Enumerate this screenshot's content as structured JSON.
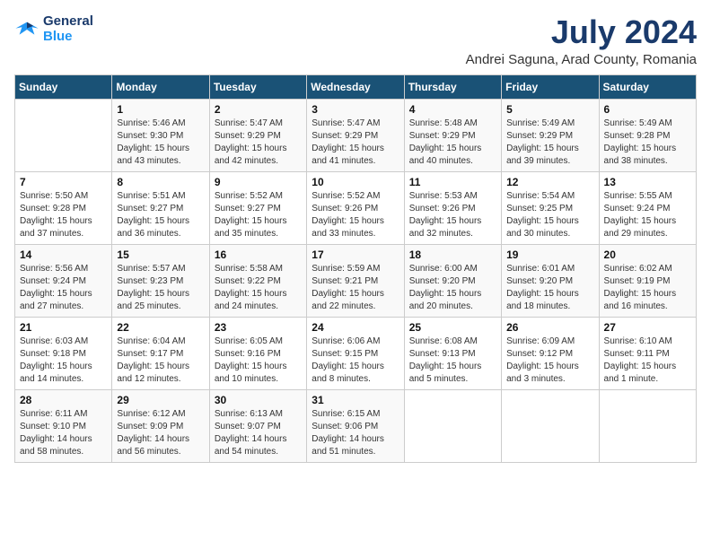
{
  "header": {
    "logo_line1": "General",
    "logo_line2": "Blue",
    "month": "July 2024",
    "location": "Andrei Saguna, Arad County, Romania"
  },
  "weekdays": [
    "Sunday",
    "Monday",
    "Tuesday",
    "Wednesday",
    "Thursday",
    "Friday",
    "Saturday"
  ],
  "weeks": [
    [
      {
        "day": "",
        "info": ""
      },
      {
        "day": "1",
        "info": "Sunrise: 5:46 AM\nSunset: 9:30 PM\nDaylight: 15 hours\nand 43 minutes."
      },
      {
        "day": "2",
        "info": "Sunrise: 5:47 AM\nSunset: 9:29 PM\nDaylight: 15 hours\nand 42 minutes."
      },
      {
        "day": "3",
        "info": "Sunrise: 5:47 AM\nSunset: 9:29 PM\nDaylight: 15 hours\nand 41 minutes."
      },
      {
        "day": "4",
        "info": "Sunrise: 5:48 AM\nSunset: 9:29 PM\nDaylight: 15 hours\nand 40 minutes."
      },
      {
        "day": "5",
        "info": "Sunrise: 5:49 AM\nSunset: 9:29 PM\nDaylight: 15 hours\nand 39 minutes."
      },
      {
        "day": "6",
        "info": "Sunrise: 5:49 AM\nSunset: 9:28 PM\nDaylight: 15 hours\nand 38 minutes."
      }
    ],
    [
      {
        "day": "7",
        "info": "Sunrise: 5:50 AM\nSunset: 9:28 PM\nDaylight: 15 hours\nand 37 minutes."
      },
      {
        "day": "8",
        "info": "Sunrise: 5:51 AM\nSunset: 9:27 PM\nDaylight: 15 hours\nand 36 minutes."
      },
      {
        "day": "9",
        "info": "Sunrise: 5:52 AM\nSunset: 9:27 PM\nDaylight: 15 hours\nand 35 minutes."
      },
      {
        "day": "10",
        "info": "Sunrise: 5:52 AM\nSunset: 9:26 PM\nDaylight: 15 hours\nand 33 minutes."
      },
      {
        "day": "11",
        "info": "Sunrise: 5:53 AM\nSunset: 9:26 PM\nDaylight: 15 hours\nand 32 minutes."
      },
      {
        "day": "12",
        "info": "Sunrise: 5:54 AM\nSunset: 9:25 PM\nDaylight: 15 hours\nand 30 minutes."
      },
      {
        "day": "13",
        "info": "Sunrise: 5:55 AM\nSunset: 9:24 PM\nDaylight: 15 hours\nand 29 minutes."
      }
    ],
    [
      {
        "day": "14",
        "info": "Sunrise: 5:56 AM\nSunset: 9:24 PM\nDaylight: 15 hours\nand 27 minutes."
      },
      {
        "day": "15",
        "info": "Sunrise: 5:57 AM\nSunset: 9:23 PM\nDaylight: 15 hours\nand 25 minutes."
      },
      {
        "day": "16",
        "info": "Sunrise: 5:58 AM\nSunset: 9:22 PM\nDaylight: 15 hours\nand 24 minutes."
      },
      {
        "day": "17",
        "info": "Sunrise: 5:59 AM\nSunset: 9:21 PM\nDaylight: 15 hours\nand 22 minutes."
      },
      {
        "day": "18",
        "info": "Sunrise: 6:00 AM\nSunset: 9:20 PM\nDaylight: 15 hours\nand 20 minutes."
      },
      {
        "day": "19",
        "info": "Sunrise: 6:01 AM\nSunset: 9:20 PM\nDaylight: 15 hours\nand 18 minutes."
      },
      {
        "day": "20",
        "info": "Sunrise: 6:02 AM\nSunset: 9:19 PM\nDaylight: 15 hours\nand 16 minutes."
      }
    ],
    [
      {
        "day": "21",
        "info": "Sunrise: 6:03 AM\nSunset: 9:18 PM\nDaylight: 15 hours\nand 14 minutes."
      },
      {
        "day": "22",
        "info": "Sunrise: 6:04 AM\nSunset: 9:17 PM\nDaylight: 15 hours\nand 12 minutes."
      },
      {
        "day": "23",
        "info": "Sunrise: 6:05 AM\nSunset: 9:16 PM\nDaylight: 15 hours\nand 10 minutes."
      },
      {
        "day": "24",
        "info": "Sunrise: 6:06 AM\nSunset: 9:15 PM\nDaylight: 15 hours\nand 8 minutes."
      },
      {
        "day": "25",
        "info": "Sunrise: 6:08 AM\nSunset: 9:13 PM\nDaylight: 15 hours\nand 5 minutes."
      },
      {
        "day": "26",
        "info": "Sunrise: 6:09 AM\nSunset: 9:12 PM\nDaylight: 15 hours\nand 3 minutes."
      },
      {
        "day": "27",
        "info": "Sunrise: 6:10 AM\nSunset: 9:11 PM\nDaylight: 15 hours\nand 1 minute."
      }
    ],
    [
      {
        "day": "28",
        "info": "Sunrise: 6:11 AM\nSunset: 9:10 PM\nDaylight: 14 hours\nand 58 minutes."
      },
      {
        "day": "29",
        "info": "Sunrise: 6:12 AM\nSunset: 9:09 PM\nDaylight: 14 hours\nand 56 minutes."
      },
      {
        "day": "30",
        "info": "Sunrise: 6:13 AM\nSunset: 9:07 PM\nDaylight: 14 hours\nand 54 minutes."
      },
      {
        "day": "31",
        "info": "Sunrise: 6:15 AM\nSunset: 9:06 PM\nDaylight: 14 hours\nand 51 minutes."
      },
      {
        "day": "",
        "info": ""
      },
      {
        "day": "",
        "info": ""
      },
      {
        "day": "",
        "info": ""
      }
    ]
  ]
}
